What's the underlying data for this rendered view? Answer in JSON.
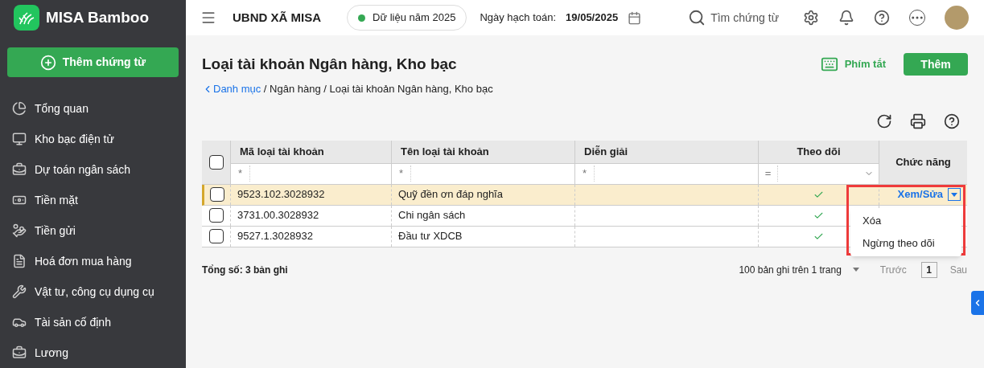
{
  "app": {
    "name": "MISA Bamboo",
    "add_voucher": "Thêm chứng từ"
  },
  "sidebar": {
    "items": [
      {
        "label": "Tổng quan",
        "kind": "chart"
      },
      {
        "label": "Kho bạc điện tử",
        "kind": "monitor"
      },
      {
        "label": "Dự toán ngân sách",
        "kind": "budget"
      },
      {
        "label": "Tiền mặt",
        "kind": "cash"
      },
      {
        "label": "Tiền gửi",
        "kind": "deposit"
      },
      {
        "label": "Hoá đơn mua hàng",
        "kind": "invoice"
      },
      {
        "label": "Vật tư, công cụ dụng cụ",
        "kind": "tools"
      },
      {
        "label": "Tài sản cố định",
        "kind": "asset"
      },
      {
        "label": "Lương",
        "kind": "budget"
      }
    ]
  },
  "header": {
    "org": "UBND XÃ MISA",
    "data_year": "Dữ liệu năm 2025",
    "date_label": "Ngày hạch toán:",
    "date": "19/05/2025",
    "search": "Tìm chứng từ"
  },
  "page": {
    "title": "Loại tài khoản Ngân hàng, Kho bạc",
    "shortcuts": "Phím tắt",
    "add": "Thêm",
    "breadcrumb": {
      "link": "Danh mục",
      "rest": " / Ngân hàng / Loại tài khoản Ngân hàng, Kho bạc"
    }
  },
  "table": {
    "columns": [
      "Mã loại tài khoản",
      "Tên loại tài khoản",
      "Diễn giải",
      "Theo dõi",
      "Chức năng"
    ],
    "filters": [
      "*",
      "*",
      "*",
      "="
    ],
    "all_checked": false,
    "rows": [
      {
        "code": "9523.102.3028932",
        "name": "Quỹ đền ơn đáp nghĩa",
        "selected": true,
        "checked": false,
        "tracked": true,
        "action": "Xem/Sửa"
      },
      {
        "code": "3731.00.3028932",
        "name": "Chi ngân sách",
        "selected": false,
        "checked": false,
        "tracked": true
      },
      {
        "code": "9527.1.3028932",
        "name": "Đầu tư XDCB",
        "selected": false,
        "checked": false,
        "tracked": true
      }
    ],
    "action_menu": [
      "Xóa",
      "Ngừng theo dõi"
    ]
  },
  "footer": {
    "total": "Tổng số: 3 bản ghi",
    "page_size": "100 bản ghi trên 1 trang",
    "prev": "Trước",
    "page": "1",
    "next": "Sau"
  }
}
